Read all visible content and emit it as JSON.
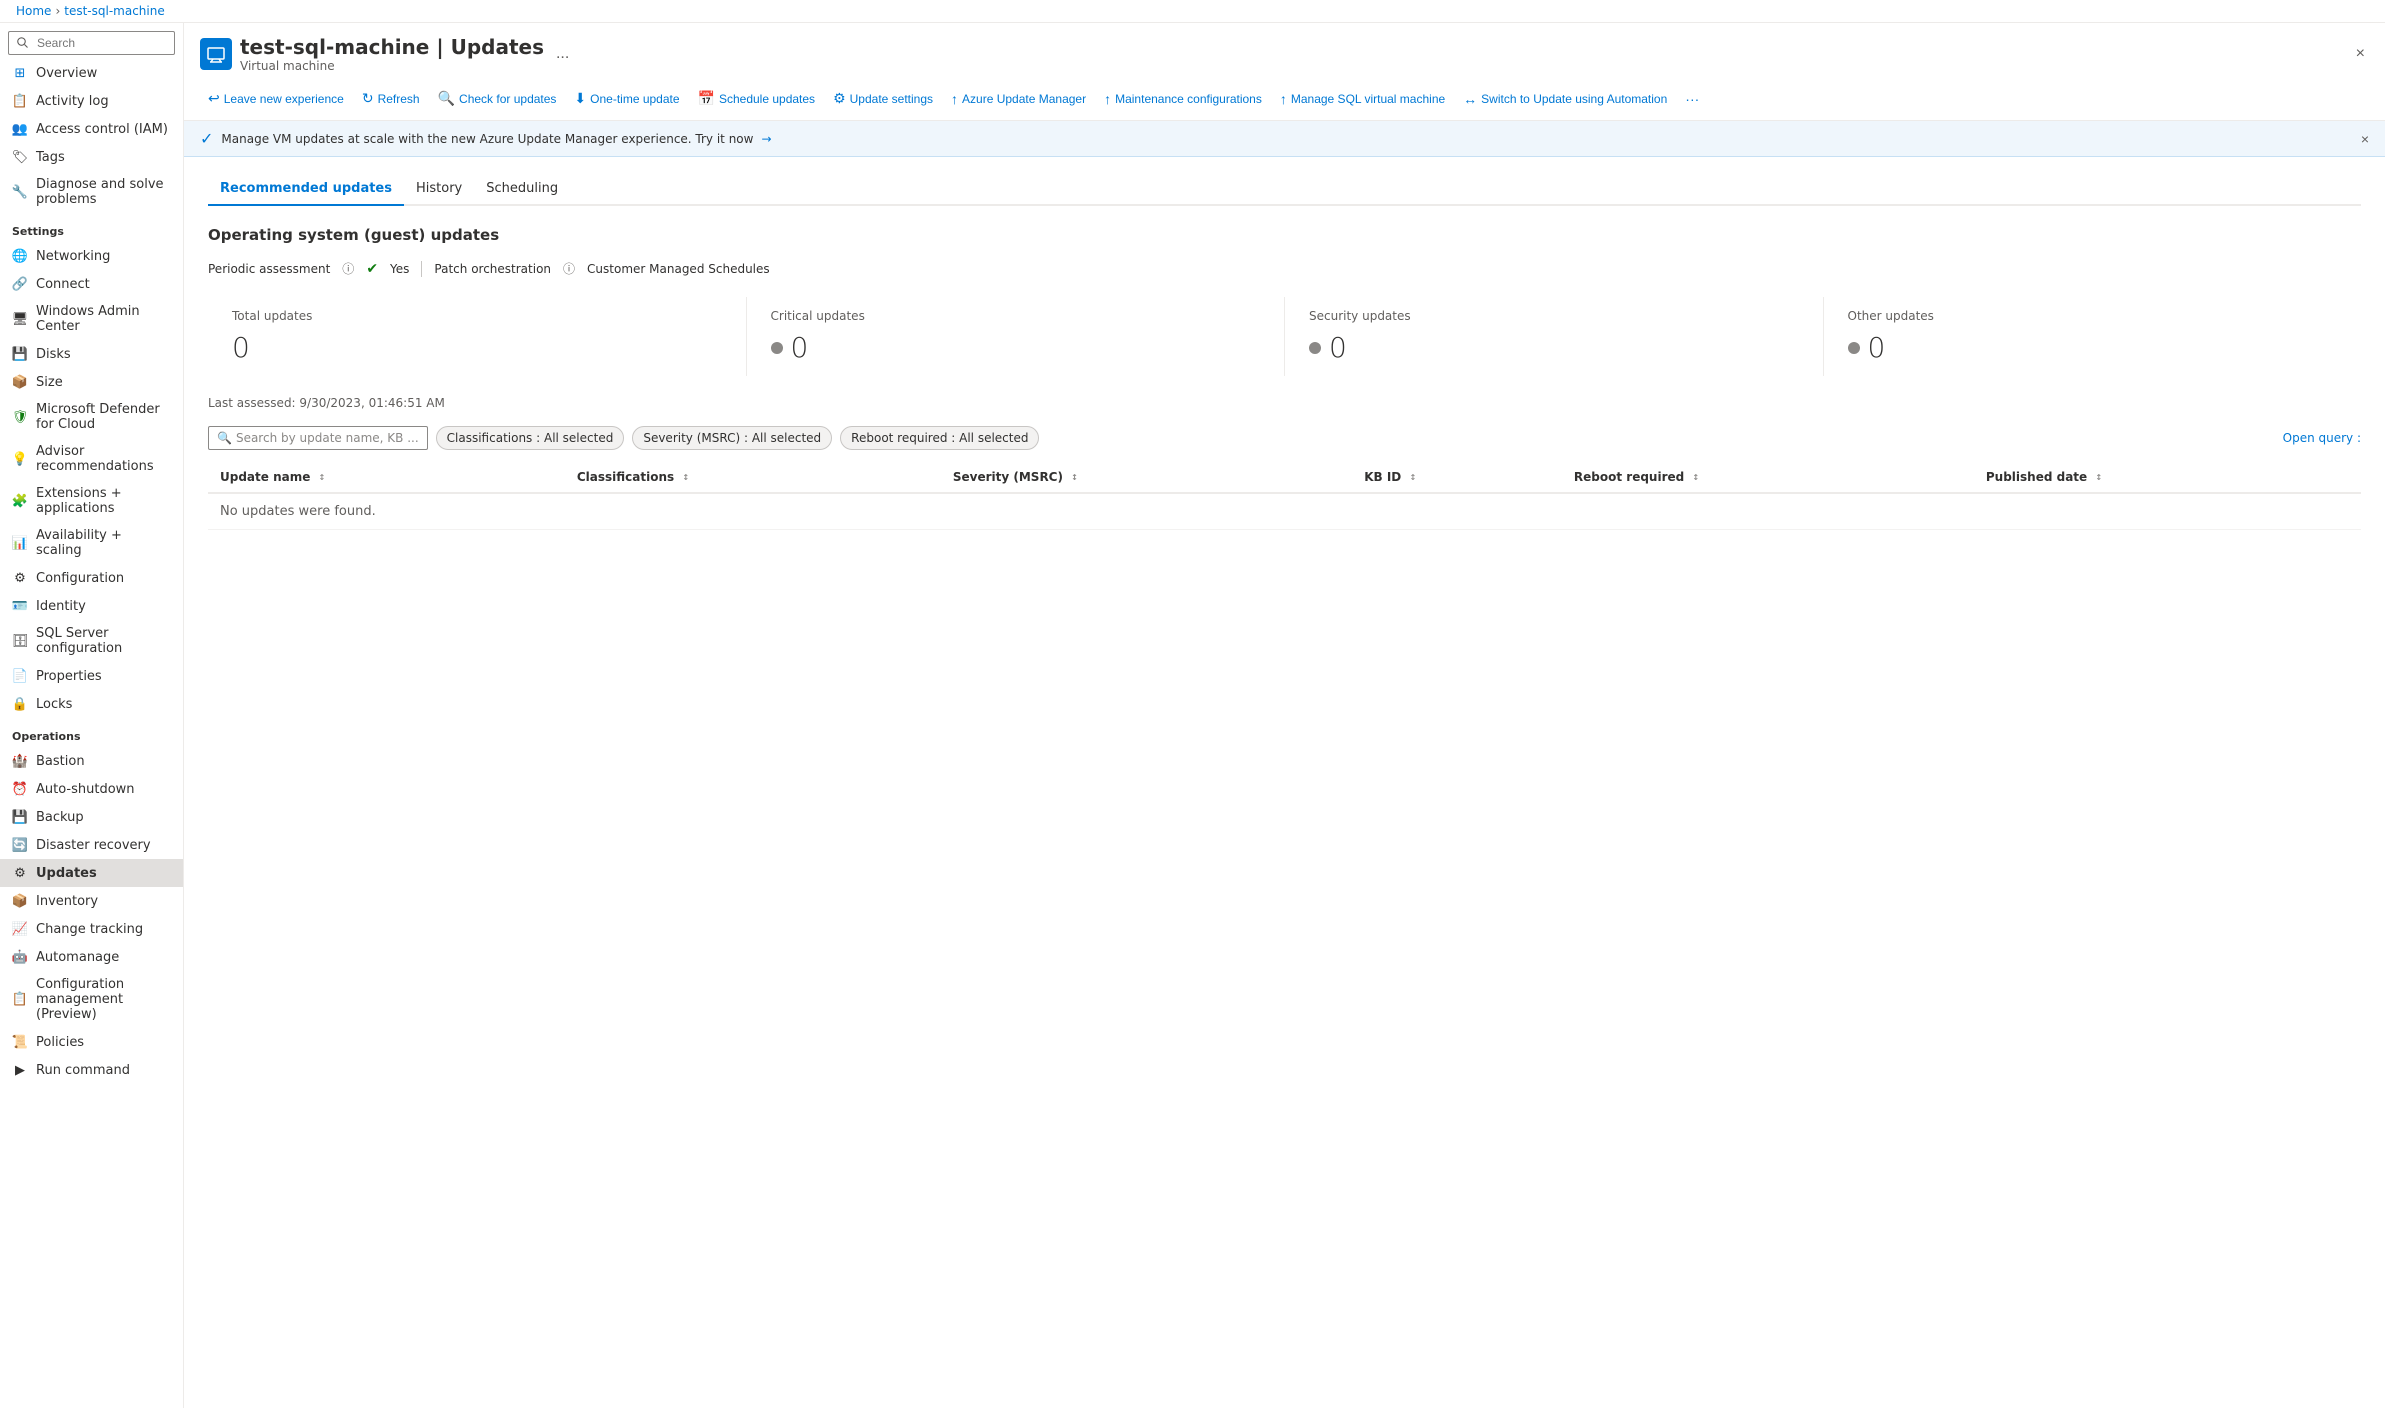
{
  "breadcrumb": {
    "home": "Home",
    "machine": "test-sql-machine"
  },
  "page": {
    "title": "test-sql-machine | Updates",
    "subtitle": "Virtual machine",
    "close_label": "×",
    "more_label": "..."
  },
  "toolbar": {
    "buttons": [
      {
        "id": "leave-new-experience",
        "icon": "↩",
        "label": "Leave new experience"
      },
      {
        "id": "refresh",
        "icon": "↻",
        "label": "Refresh"
      },
      {
        "id": "check-updates",
        "icon": "🔍",
        "label": "Check for updates"
      },
      {
        "id": "one-time-update",
        "icon": "⬇",
        "label": "One-time update"
      },
      {
        "id": "schedule-updates",
        "icon": "📅",
        "label": "Schedule updates"
      },
      {
        "id": "update-settings",
        "icon": "⚙",
        "label": "Update settings"
      },
      {
        "id": "azure-update-manager",
        "icon": "↑",
        "label": "Azure Update Manager"
      },
      {
        "id": "maintenance-config",
        "icon": "↑",
        "label": "Maintenance configurations"
      },
      {
        "id": "manage-sql",
        "icon": "↑",
        "label": "Manage SQL virtual machine"
      },
      {
        "id": "switch-automation",
        "icon": "↔",
        "label": "Switch to Update using Automation"
      },
      {
        "id": "more",
        "icon": "...",
        "label": "More"
      }
    ]
  },
  "banner": {
    "text": "Manage VM updates at scale with the new Azure Update Manager experience. Try it now",
    "link": "→"
  },
  "tabs": [
    {
      "id": "recommended",
      "label": "Recommended updates",
      "active": true
    },
    {
      "id": "history",
      "label": "History",
      "active": false
    },
    {
      "id": "scheduling",
      "label": "Scheduling",
      "active": false
    }
  ],
  "section": {
    "title": "Operating system (guest) updates",
    "periodic_assessment_label": "Periodic assessment",
    "periodic_assessment_value": "Yes",
    "patch_orchestration_label": "Patch orchestration",
    "customer_managed_label": "Customer Managed Schedules"
  },
  "update_cards": [
    {
      "id": "total",
      "label": "Total updates",
      "value": "0",
      "dot": false
    },
    {
      "id": "critical",
      "label": "Critical updates",
      "value": "0",
      "dot": true
    },
    {
      "id": "security",
      "label": "Security updates",
      "value": "0",
      "dot": true
    },
    {
      "id": "other",
      "label": "Other updates",
      "value": "0",
      "dot": true
    }
  ],
  "last_assessed": "Last assessed: 9/30/2023, 01:46:51 AM",
  "filters": {
    "search_placeholder": "Search by update name, KB ...",
    "tags": [
      {
        "id": "classifications",
        "label": "Classifications : All selected"
      },
      {
        "id": "severity",
        "label": "Severity (MSRC) : All selected"
      },
      {
        "id": "reboot",
        "label": "Reboot required : All selected"
      }
    ],
    "open_query": "Open query :"
  },
  "table": {
    "columns": [
      {
        "id": "update-name",
        "label": "Update name"
      },
      {
        "id": "classifications",
        "label": "Classifications"
      },
      {
        "id": "severity",
        "label": "Severity (MSRC)"
      },
      {
        "id": "kb-id",
        "label": "KB ID"
      },
      {
        "id": "reboot-required",
        "label": "Reboot required"
      },
      {
        "id": "published-date",
        "label": "Published date"
      }
    ],
    "empty_message": "No updates were found."
  },
  "sidebar": {
    "search_placeholder": "Search",
    "nav_items": [
      {
        "id": "overview",
        "label": "Overview",
        "icon": "⊞",
        "section": null
      },
      {
        "id": "activity-log",
        "label": "Activity log",
        "icon": "📋",
        "section": null
      },
      {
        "id": "access-control",
        "label": "Access control (IAM)",
        "icon": "👥",
        "section": null
      },
      {
        "id": "tags",
        "label": "Tags",
        "icon": "🏷",
        "section": null
      },
      {
        "id": "diagnose",
        "label": "Diagnose and solve problems",
        "icon": "🔧",
        "section": null
      },
      {
        "id": "settings-header",
        "label": "Settings",
        "section": "Settings"
      },
      {
        "id": "networking",
        "label": "Networking",
        "icon": "🌐",
        "section": "Settings"
      },
      {
        "id": "connect",
        "label": "Connect",
        "icon": "🔗",
        "section": "Settings"
      },
      {
        "id": "windows-admin",
        "label": "Windows Admin Center",
        "icon": "🖥",
        "section": "Settings"
      },
      {
        "id": "disks",
        "label": "Disks",
        "icon": "💾",
        "section": "Settings"
      },
      {
        "id": "size",
        "label": "Size",
        "icon": "📦",
        "section": "Settings"
      },
      {
        "id": "defender",
        "label": "Microsoft Defender for Cloud",
        "icon": "🛡",
        "section": "Settings"
      },
      {
        "id": "advisor",
        "label": "Advisor recommendations",
        "icon": "💡",
        "section": "Settings"
      },
      {
        "id": "extensions",
        "label": "Extensions + applications",
        "icon": "🧩",
        "section": "Settings"
      },
      {
        "id": "availability",
        "label": "Availability + scaling",
        "icon": "📊",
        "section": "Settings"
      },
      {
        "id": "configuration",
        "label": "Configuration",
        "icon": "⚙",
        "section": "Settings"
      },
      {
        "id": "identity",
        "label": "Identity",
        "icon": "🪪",
        "section": "Settings"
      },
      {
        "id": "sql-server-config",
        "label": "SQL Server configuration",
        "icon": "🗄",
        "section": "Settings"
      },
      {
        "id": "properties",
        "label": "Properties",
        "icon": "📄",
        "section": "Settings"
      },
      {
        "id": "locks",
        "label": "Locks",
        "icon": "🔒",
        "section": "Settings"
      },
      {
        "id": "operations-header",
        "label": "Operations",
        "section": "Operations"
      },
      {
        "id": "bastion",
        "label": "Bastion",
        "icon": "🏰",
        "section": "Operations"
      },
      {
        "id": "auto-shutdown",
        "label": "Auto-shutdown",
        "icon": "⏰",
        "section": "Operations"
      },
      {
        "id": "backup",
        "label": "Backup",
        "icon": "💾",
        "section": "Operations"
      },
      {
        "id": "disaster-recovery",
        "label": "Disaster recovery",
        "icon": "🔄",
        "section": "Operations"
      },
      {
        "id": "updates",
        "label": "Updates",
        "icon": "⚙",
        "section": "Operations",
        "active": true
      },
      {
        "id": "inventory",
        "label": "Inventory",
        "icon": "📦",
        "section": "Operations"
      },
      {
        "id": "change-tracking",
        "label": "Change tracking",
        "icon": "📈",
        "section": "Operations"
      },
      {
        "id": "automanage",
        "label": "Automanage",
        "icon": "🤖",
        "section": "Operations"
      },
      {
        "id": "config-management",
        "label": "Configuration management (Preview)",
        "icon": "📋",
        "section": "Operations"
      },
      {
        "id": "policies",
        "label": "Policies",
        "icon": "📜",
        "section": "Operations"
      },
      {
        "id": "run-command",
        "label": "Run command",
        "icon": "▶",
        "section": "Operations"
      }
    ]
  }
}
